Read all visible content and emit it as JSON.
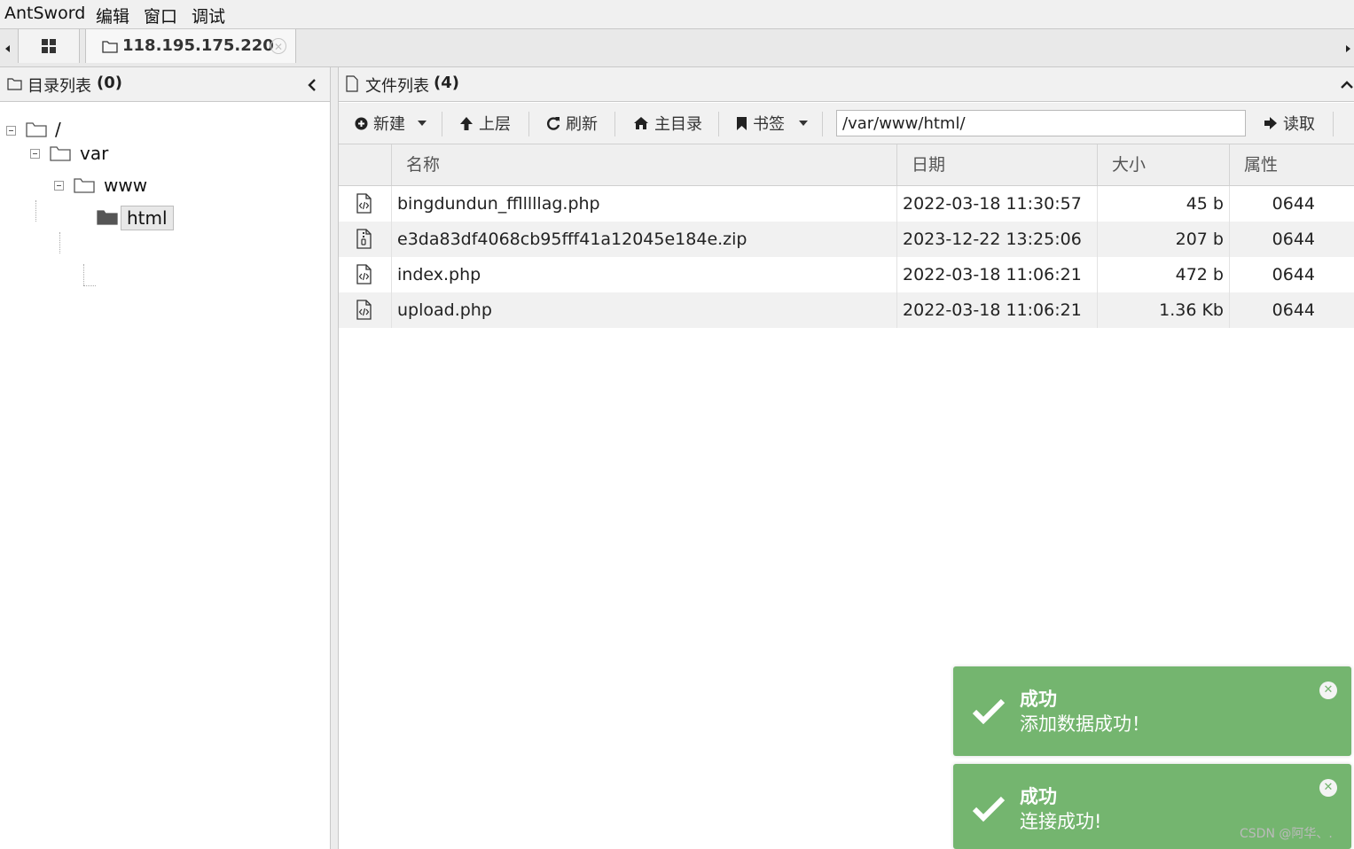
{
  "menubar": {
    "app_name": "AntSword",
    "items": [
      "编辑",
      "窗口",
      "调试"
    ]
  },
  "tabs": {
    "home_icon": "grid-icon",
    "active_tab_label": "118.195.175.220",
    "close_icon": "close-circle-icon"
  },
  "left_pane": {
    "title": "目录列表",
    "count": "(0)",
    "collapse_icon": "chevron-left-icon",
    "tree": [
      {
        "label": "/"
      },
      {
        "label": "var"
      },
      {
        "label": "www"
      },
      {
        "label": "html",
        "selected": true
      }
    ]
  },
  "right_pane": {
    "title": "文件列表",
    "count": "(4)",
    "collapse_icon": "chevron-up-icon",
    "toolbar": {
      "new_label": "新建",
      "up_label": "上层",
      "refresh_label": "刷新",
      "home_label": "主目录",
      "bookmark_label": "书签",
      "path_value": "/var/www/html/",
      "read_label": "读取"
    },
    "columns": [
      "名称",
      "日期",
      "大小",
      "属性"
    ],
    "rows": [
      {
        "icon": "php-file-icon",
        "name": "bingdundun_fflllllag.php",
        "date": "2022-03-18 11:30:57",
        "size": "45 b",
        "perm": "0644"
      },
      {
        "icon": "zip-file-icon",
        "name": "e3da83df4068cb95fff41a12045e184e.zip",
        "date": "2023-12-22 13:25:06",
        "size": "207 b",
        "perm": "0644"
      },
      {
        "icon": "php-file-icon",
        "name": "index.php",
        "date": "2022-03-18 11:06:21",
        "size": "472 b",
        "perm": "0644"
      },
      {
        "icon": "php-file-icon",
        "name": "upload.php",
        "date": "2022-03-18 11:06:21",
        "size": "1.36 Kb",
        "perm": "0644"
      }
    ]
  },
  "toasts": [
    {
      "title": "成功",
      "message": "添加数据成功！"
    },
    {
      "title": "成功",
      "message": "连接成功!"
    }
  ],
  "colors": {
    "toast_bg": "#74b56f",
    "header_bg": "#f1f1f1",
    "row_alt": "#f1f1f1"
  },
  "watermark": "CSDN @阿华、."
}
